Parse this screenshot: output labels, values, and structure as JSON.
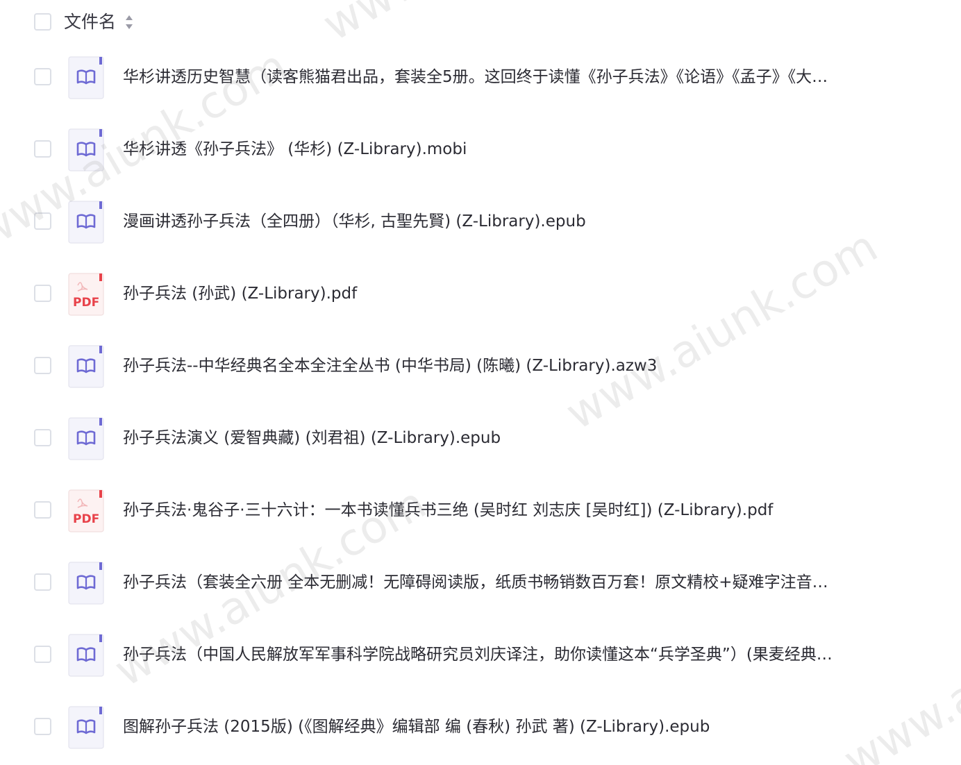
{
  "header": {
    "label": "文件名"
  },
  "files": [
    {
      "name": "华杉讲透历史智慧（读客熊猫君出品，套装全5册。这回终于读懂《孙子兵法》《论语》《孟子》《大…",
      "type": "ebook"
    },
    {
      "name": "华杉讲透《孙子兵法》 (华杉) (Z-Library).mobi",
      "type": "ebook"
    },
    {
      "name": "漫画讲透孙子兵法（全四册）（华杉, 古聖先賢) (Z-Library).epub",
      "type": "ebook"
    },
    {
      "name": "孙子兵法 (孙武) (Z-Library).pdf",
      "type": "pdf"
    },
    {
      "name": "孙子兵法--中华经典名全本全注全丛书 (中华书局) (陈曦) (Z-Library).azw3",
      "type": "ebook"
    },
    {
      "name": "孙子兵法演义 (爱智典藏) (刘君祖) (Z-Library).epub",
      "type": "ebook"
    },
    {
      "name": "孙子兵法·鬼谷子·三十六计：一本书读懂兵书三绝 (吴时红 刘志庆 [吴时红]) (Z-Library).pdf",
      "type": "pdf"
    },
    {
      "name": "孙子兵法（套装全六册 全本无删减！无障碍阅读版，纸质书畅销数百万套！原文精校+疑难字注音…",
      "type": "ebook"
    },
    {
      "name": "孙子兵法（中国人民解放军军事科学院战略研究员刘庆译注，助你读懂这本“兵学圣典”）(果麦经典…",
      "type": "ebook"
    },
    {
      "name": "图解孙子兵法 (2015版) (《图解经典》编辑部 编 (春秋) 孙武 著) (Z-Library).epub",
      "type": "ebook"
    }
  ],
  "icons": {
    "ebook": "book-icon",
    "pdf": "pdf-icon",
    "pdf_label": "PDF"
  },
  "watermark": {
    "text": "www.aiunk.com"
  },
  "colors": {
    "ebook_accent": "#6e6ad4",
    "pdf_accent": "#e8424a",
    "checkbox_border": "#dcdfe6"
  }
}
